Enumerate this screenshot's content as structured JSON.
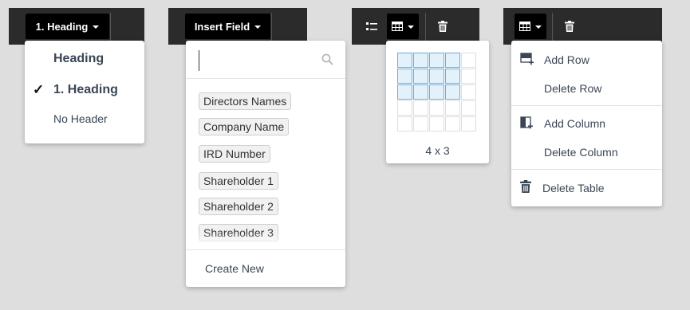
{
  "toolbar1": {
    "heading_button": "1. Heading"
  },
  "heading_menu": {
    "items": [
      {
        "label": "Heading",
        "checked": false
      },
      {
        "label": "1. Heading",
        "checked": true
      },
      {
        "label": "No Header",
        "checked": false
      }
    ],
    "check_glyph": "✓"
  },
  "toolbar2": {
    "insert_button": "Insert Field"
  },
  "insert_menu": {
    "search_value": "",
    "fields": [
      "Directors Names",
      "Company Name",
      "IRD Number",
      "Shareholder 1",
      "Shareholder 2",
      "Shareholder 3"
    ],
    "create_label": "Create New"
  },
  "table_picker": {
    "columns": 5,
    "rows": 5,
    "selected_columns": 4,
    "selected_rows": 3,
    "size_label": "4 x 3"
  },
  "table_menu": {
    "add_row": "Add Row",
    "delete_row": "Delete Row",
    "add_column": "Add Column",
    "delete_column": "Delete Column",
    "delete_table": "Delete Table"
  },
  "colors": {
    "toolbar_bg": "#2b2b2b",
    "button_bg": "#000000",
    "text": "#3a4654",
    "cell_selected_bg": "#e3f1fa",
    "cell_selected_border": "#6aaedb"
  }
}
